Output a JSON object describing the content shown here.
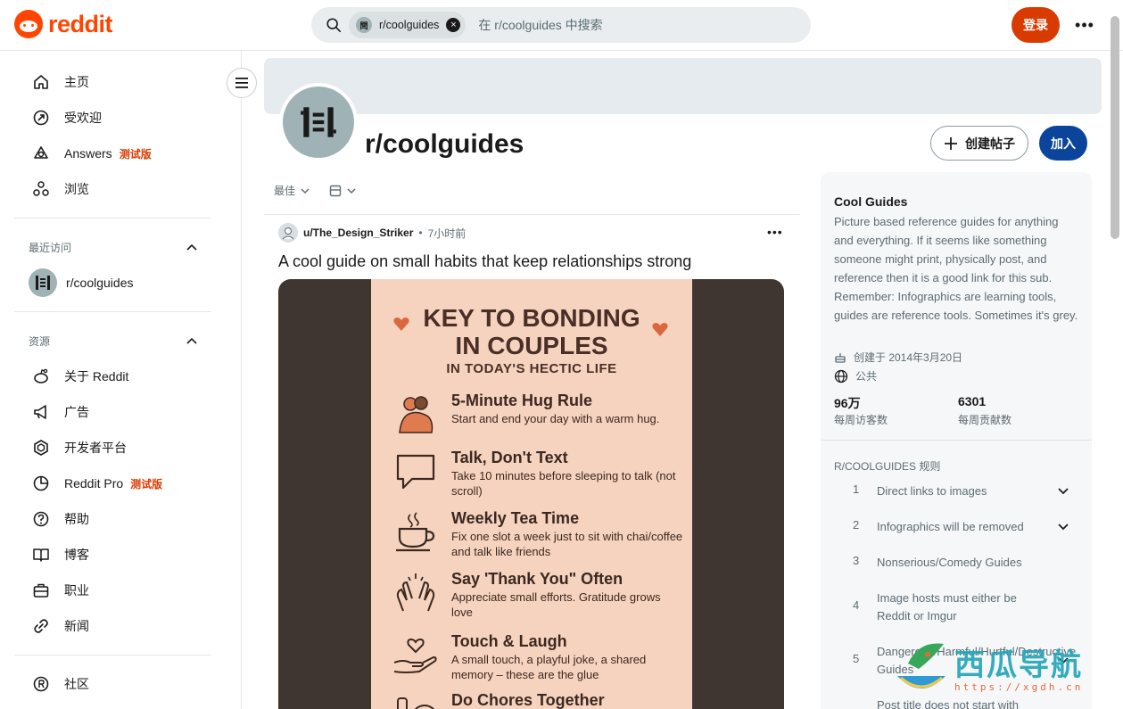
{
  "header": {
    "logo_text": "reddit",
    "search_chip": "r/coolguides",
    "search_chip_icon": "閆",
    "search_placeholder": "在 r/coolguides 中搜索",
    "login_label": "登录",
    "more_label": "•••"
  },
  "sidebar": {
    "nav": [
      {
        "label": "主页",
        "icon": "home-icon"
      },
      {
        "label": "受欢迎",
        "icon": "popular-icon"
      },
      {
        "label": "Answers",
        "icon": "answers-icon",
        "badge": "测试版"
      },
      {
        "label": "浏览",
        "icon": "explore-icon"
      }
    ],
    "recent_heading": "最近访问",
    "recent": [
      {
        "label": "r/coolguides"
      }
    ],
    "resources_heading": "资源",
    "resources": [
      {
        "label": "关于 Reddit",
        "icon": "reddit-alien-icon"
      },
      {
        "label": "广告",
        "icon": "megaphone-icon"
      },
      {
        "label": "开发者平台",
        "icon": "developer-icon"
      },
      {
        "label": "Reddit Pro",
        "icon": "pie-chart-icon",
        "badge": "测试版"
      },
      {
        "label": "帮助",
        "icon": "help-icon"
      },
      {
        "label": "博客",
        "icon": "book-icon"
      },
      {
        "label": "职业",
        "icon": "briefcase-icon"
      },
      {
        "label": "新闻",
        "icon": "link-icon"
      }
    ],
    "communities_label": "社区"
  },
  "subreddit": {
    "name": "r/coolguides",
    "avatar_glyph": "閆",
    "create_post_label": "创建帖子",
    "join_label": "加入"
  },
  "feed": {
    "sort_label": "最佳",
    "post": {
      "user": "u/The_Design_Striker",
      "separator": "•",
      "time": "7小时前",
      "more": "•••",
      "title": "A cool guide on small habits that keep relationships strong",
      "image": {
        "title_line1": "KEY TO BONDING",
        "title_line2": "IN COUPLES",
        "subtitle": "IN TODAY'S HECTIC LIFE",
        "items": [
          {
            "heading": "5-Minute Hug Rule",
            "text": "Start and end your day with a warm hug."
          },
          {
            "heading": "Talk, Don't Text",
            "text": "Take 10 minutes before sleeping to talk (not scroll)"
          },
          {
            "heading": "Weekly Tea Time",
            "text": "Fix one slot a week just to sit with chai/coffee and talk like friends"
          },
          {
            "heading": "Say 'Thank You\" Often",
            "text": "Appreciate small efforts. Gratitude grows love"
          },
          {
            "heading": "Touch & Laugh",
            "text": "A small touch, a playful joke, a shared memory – these are the glue"
          },
          {
            "heading": "Do Chores Together",
            "text": ""
          }
        ]
      }
    }
  },
  "about": {
    "title": "Cool Guides",
    "description": "Picture based reference guides for anything and everything. If it seems like something someone might print, physically post, and reference then it is a good link for this sub. Remember: Infographics are learning tools, guides are reference tools. Sometimes it's grey.",
    "created": "创建于 2014年3月20日",
    "visibility": "公共",
    "weekly_visitors": "96万",
    "weekly_visitors_label": "每周访客数",
    "weekly_contributions": "6301",
    "weekly_contributions_label": "每周贡献数",
    "rules_heading": "R/COOLGUIDES 规则",
    "rules": [
      {
        "num": "1",
        "text": "Direct links to images",
        "expandable": true
      },
      {
        "num": "2",
        "text": "Infographics will be removed",
        "expandable": true
      },
      {
        "num": "3",
        "text": "Nonserious/Comedy Guides",
        "expandable": false
      },
      {
        "num": "4",
        "text": "Image hosts must either be Reddit or Imgur",
        "expandable": false
      },
      {
        "num": "5",
        "text": "Dangerous/Harmful/Hurtful/Destructive Guides",
        "expandable": true
      },
      {
        "num": "",
        "text": "Post title does not start with",
        "expandable": false
      }
    ]
  },
  "watermark": {
    "text": "西瓜导航",
    "url": "https://xgdh.cn"
  },
  "colors": {
    "brand": "#ff4500",
    "login_bg": "#d93a00",
    "join_bg": "#0a449b",
    "beta": "#d93a00"
  }
}
